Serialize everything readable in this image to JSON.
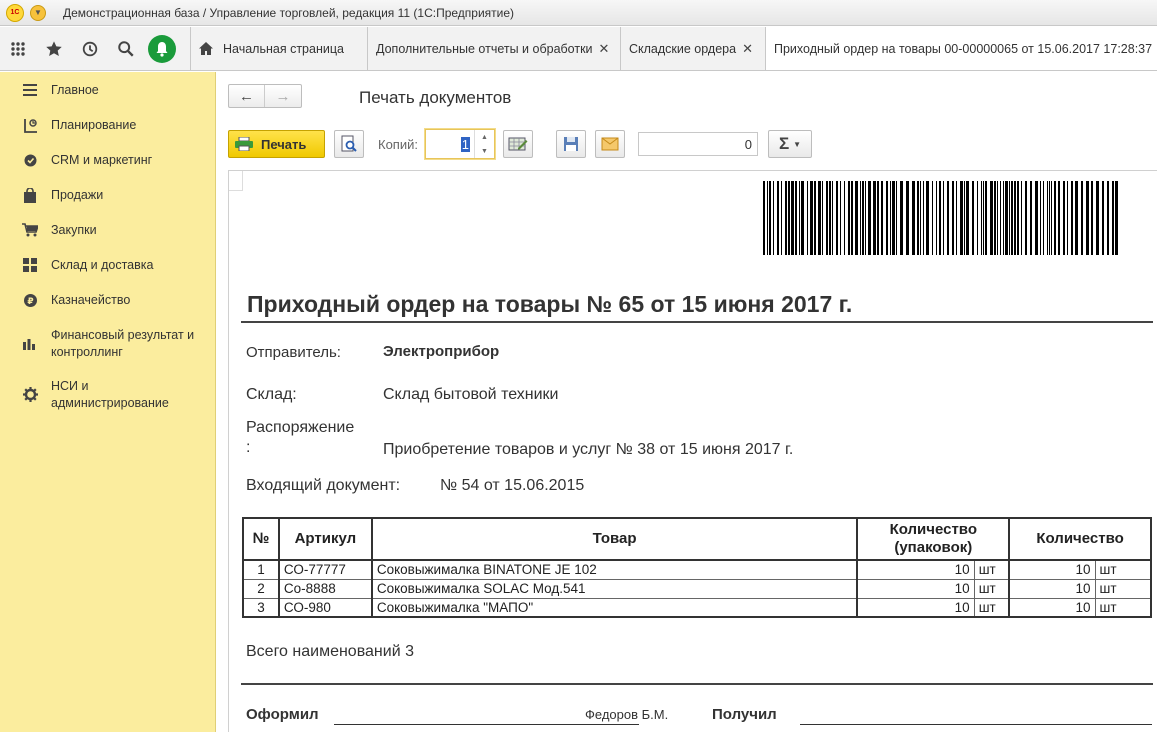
{
  "titlebar": {
    "title": "Демонстрационная база / Управление торговлей, редакция 11  (1С:Предприятие)",
    "logo": "1С"
  },
  "tabs": [
    {
      "label": "Начальная страница"
    },
    {
      "label": "Дополнительные отчеты и обработки"
    },
    {
      "label": "Складские ордера"
    },
    {
      "label": "Приходный ордер на товары 00-00000065 от 15.06.2017 17:28:37"
    }
  ],
  "sidebar": {
    "items": [
      {
        "label": "Главное",
        "icon": "menu-icon"
      },
      {
        "label": "Планирование",
        "icon": "planning-icon"
      },
      {
        "label": "CRM и маркетинг",
        "icon": "crm-icon"
      },
      {
        "label": "Продажи",
        "icon": "bag-icon"
      },
      {
        "label": "Закупки",
        "icon": "cart-icon"
      },
      {
        "label": "Склад и доставка",
        "icon": "warehouse-icon"
      },
      {
        "label": "Казначейство",
        "icon": "ruble-icon"
      },
      {
        "label": "Финансовый результат и контроллинг",
        "icon": "chart-icon"
      },
      {
        "label": "НСИ и администрирование",
        "icon": "gear-icon"
      }
    ]
  },
  "form": {
    "title": "Печать документов",
    "print_label": "Печать",
    "copies_label": "Копий:",
    "copies_value": "1",
    "sum_value": "0",
    "sigma_label": "Σ"
  },
  "document": {
    "title": "Приходный ордер на товары № 65 от 15 июня 2017 г.",
    "sender_label": "Отправитель:",
    "sender_value": "Электроприбор",
    "warehouse_label": "Склад:",
    "warehouse_value": "Склад бытовой техники",
    "order_label_1": "Распоряжение",
    "order_label_2": ":",
    "order_value": "Приобретение товаров и услуг № 38 от 15 июня 2017 г.",
    "incoming_label": "Входящий документ:",
    "incoming_value": "№ 54 от 15.06.2015",
    "table": {
      "headers": [
        "№",
        "Артикул",
        "Товар",
        "Количество (упаковок)",
        "Количество"
      ],
      "rows": [
        {
          "n": "1",
          "article": "СО-77777",
          "product": "Соковыжималка  BINATONE JE 102",
          "qty_pack": "10",
          "unit_pack": "шт",
          "qty": "10",
          "unit": "шт"
        },
        {
          "n": "2",
          "article": "Со-8888",
          "product": "Соковыжималка  SOLAC  Мод.541",
          "qty_pack": "10",
          "unit_pack": "шт",
          "qty": "10",
          "unit": "шт"
        },
        {
          "n": "3",
          "article": "СО-980",
          "product": "Соковыжималка \"МАПО\"",
          "qty_pack": "10",
          "unit_pack": "шт",
          "qty": "10",
          "unit": "шт"
        }
      ]
    },
    "total_label": "Всего наименований 3",
    "issued_label": "Оформил",
    "issued_name": "Федоров Б.М.",
    "received_label": "Получил"
  }
}
